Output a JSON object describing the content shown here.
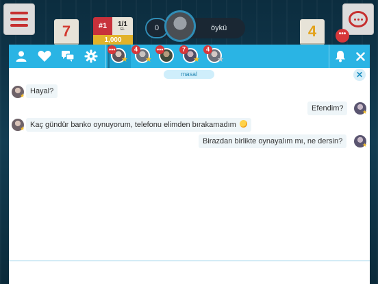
{
  "game": {
    "tile_left": "7",
    "tile_right": "4",
    "rank": "#1",
    "round": "1/1",
    "round_sub": "EL",
    "stake": "1,000",
    "player_score": "0",
    "player_name": "öykü",
    "notif_count": "•••"
  },
  "chat": {
    "partner": "masal",
    "input_placeholder": "",
    "conversations": [
      {
        "badge": "•••",
        "star": "gold",
        "active": true
      },
      {
        "badge": "4",
        "star": "gold",
        "active": false
      },
      {
        "badge": "•••",
        "star": "none",
        "active": false
      },
      {
        "badge": "7",
        "star": "gold",
        "active": false
      },
      {
        "badge": "4",
        "star": "grey",
        "active": false
      }
    ],
    "messages": [
      {
        "from": "partner",
        "text": "Hayal?"
      },
      {
        "from": "me",
        "text": "Efendim?"
      },
      {
        "from": "partner",
        "text": "Kaç gündür banko oynuyorum, telefonu elimden bırakamadım"
      },
      {
        "from": "me",
        "text": "Birazdan birlikte oynayalım mı, ne dersin?"
      }
    ]
  },
  "colors": {
    "toolbar": "#2ab4e4",
    "badge": "#d7373a",
    "star": "#f6c02c"
  },
  "icons": [
    "menu-icon",
    "chat-icon",
    "user-icon",
    "heart-icon",
    "chat-bubbles-icon",
    "settings-icon",
    "bell-icon",
    "close-icon",
    "star-icon",
    "smiley-emoji-icon"
  ]
}
